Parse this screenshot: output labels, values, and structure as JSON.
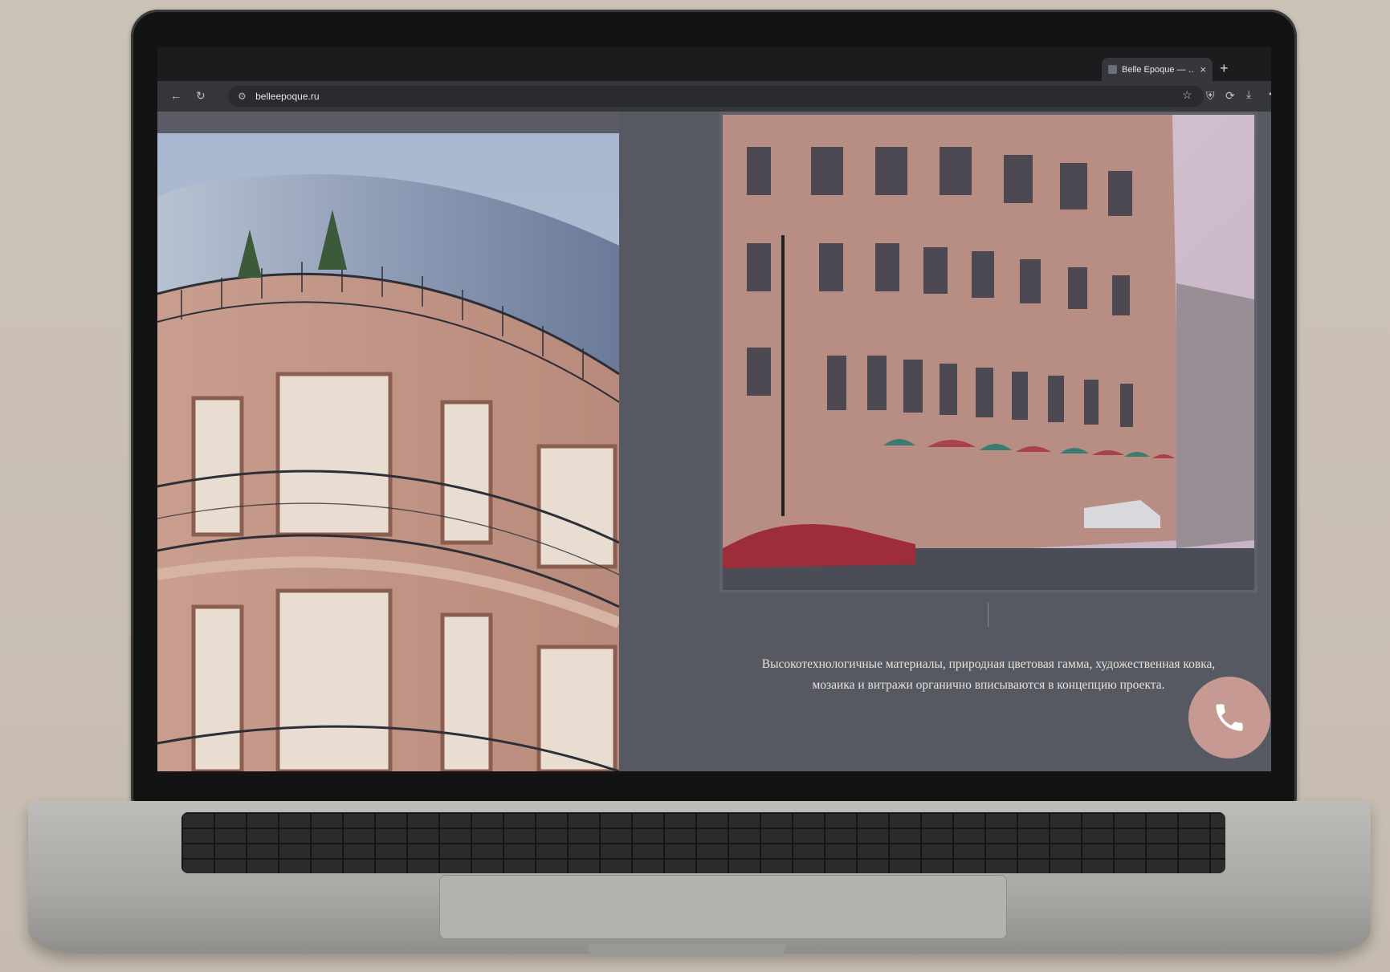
{
  "browser": {
    "tab_title": "Belle Epoque — …",
    "tab_close": "×",
    "new_tab": "+",
    "url": "belleepoque.ru"
  },
  "page": {
    "description": "Высокотехнологичные материалы, природная цветовая гамма, художественная ковка, мозаика и витражи органично вписываются в концепцию проекта."
  },
  "icons": {
    "back": "back-arrow-icon",
    "reload": "reload-icon",
    "site_info": "site-info-icon",
    "bookmark": "star-icon",
    "shield": "shield-icon",
    "sync": "sync-icon",
    "download": "download-icon",
    "extensions": "puzzle-icon",
    "call": "phone-icon"
  },
  "colors": {
    "page_bg": "#575962",
    "text": "#e7e2dc",
    "call_button": "#c69a92"
  }
}
